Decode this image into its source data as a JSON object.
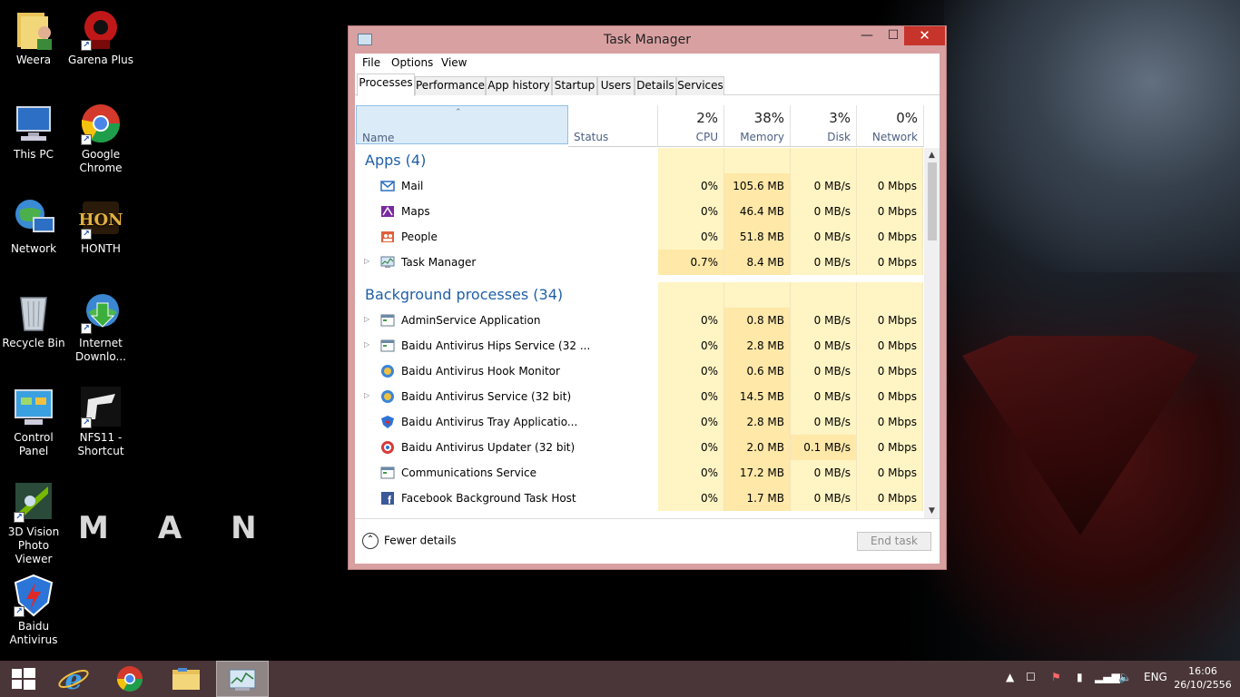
{
  "desktop": {
    "icons": [
      {
        "label": "Weera"
      },
      {
        "label": "Garena Plus"
      },
      {
        "label": "This PC"
      },
      {
        "label": "Google Chrome"
      },
      {
        "label": "Network"
      },
      {
        "label": "HONTH"
      },
      {
        "label": "Recycle Bin"
      },
      {
        "label": "Internet Downlo..."
      },
      {
        "label": "Control Panel"
      },
      {
        "label": "NFS11 - Shortcut"
      },
      {
        "label": "3D Vision Photo Viewer"
      },
      {
        "label": "Baidu Antivirus"
      }
    ],
    "wallpaper_text": "MAN O"
  },
  "window": {
    "title": "Task Manager",
    "min_glyph": "—",
    "max_glyph": "☐",
    "close_glyph": "✕"
  },
  "menu": {
    "file": "File",
    "options": "Options",
    "view": "View"
  },
  "tabs": [
    "Processes",
    "Performance",
    "App history",
    "Startup",
    "Users",
    "Details",
    "Services"
  ],
  "columns": {
    "name": "Name",
    "status": "Status",
    "cpu": {
      "pct": "2%",
      "label": "CPU"
    },
    "memory": {
      "pct": "38%",
      "label": "Memory"
    },
    "disk": {
      "pct": "3%",
      "label": "Disk"
    },
    "network": {
      "pct": "0%",
      "label": "Network"
    }
  },
  "groups": {
    "apps": "Apps (4)",
    "background": "Background processes (34)"
  },
  "apps": [
    {
      "name": "Mail",
      "cpu": "0%",
      "memory": "105.6 MB",
      "disk": "0 MB/s",
      "network": "0 Mbps",
      "icon": "mail-icon"
    },
    {
      "name": "Maps",
      "cpu": "0%",
      "memory": "46.4 MB",
      "disk": "0 MB/s",
      "network": "0 Mbps",
      "icon": "maps-icon"
    },
    {
      "name": "People",
      "cpu": "0%",
      "memory": "51.8 MB",
      "disk": "0 MB/s",
      "network": "0 Mbps",
      "icon": "people-icon"
    },
    {
      "name": "Task Manager",
      "cpu": "0.7%",
      "memory": "8.4 MB",
      "disk": "0 MB/s",
      "network": "0 Mbps",
      "icon": "task-manager-icon"
    }
  ],
  "background": [
    {
      "name": "AdminService Application",
      "cpu": "0%",
      "memory": "0.8 MB",
      "disk": "0 MB/s",
      "network": "0 Mbps",
      "icon": "app-window-icon"
    },
    {
      "name": "Baidu Antivirus Hips Service (32 ...",
      "cpu": "0%",
      "memory": "2.8 MB",
      "disk": "0 MB/s",
      "network": "0 Mbps",
      "icon": "app-window-icon"
    },
    {
      "name": "Baidu Antivirus Hook Monitor",
      "cpu": "0%",
      "memory": "0.6 MB",
      "disk": "0 MB/s",
      "network": "0 Mbps",
      "icon": "baidu-icon"
    },
    {
      "name": "Baidu Antivirus Service (32 bit)",
      "cpu": "0%",
      "memory": "14.5 MB",
      "disk": "0 MB/s",
      "network": "0 Mbps",
      "icon": "baidu-icon"
    },
    {
      "name": "Baidu Antivirus Tray Applicatio...",
      "cpu": "0%",
      "memory": "2.8 MB",
      "disk": "0 MB/s",
      "network": "0 Mbps",
      "icon": "baidu-shield-icon"
    },
    {
      "name": "Baidu Antivirus Updater (32 bit)",
      "cpu": "0%",
      "memory": "2.0 MB",
      "disk": "0.1 MB/s",
      "network": "0 Mbps",
      "icon": "baidu-updater-icon"
    },
    {
      "name": "Communications Service",
      "cpu": "0%",
      "memory": "17.2 MB",
      "disk": "0 MB/s",
      "network": "0 Mbps",
      "icon": "app-window-icon"
    },
    {
      "name": "Facebook Background Task Host",
      "cpu": "0%",
      "memory": "1.7 MB",
      "disk": "0 MB/s",
      "network": "0 Mbps",
      "icon": "facebook-icon"
    }
  ],
  "footer": {
    "fewer": "Fewer details",
    "end_task": "End task"
  },
  "taskbar": {
    "lang": "ENG",
    "time": "16:06",
    "date": "26/10/2556"
  },
  "colors": {
    "window_frame": "#d9a0a2",
    "heat": "#fff4c4",
    "heat_medium": "#ffe8a8",
    "group_blue": "#1f5fa8",
    "taskbar": "#4a3638",
    "close_red": "#c7342b"
  }
}
